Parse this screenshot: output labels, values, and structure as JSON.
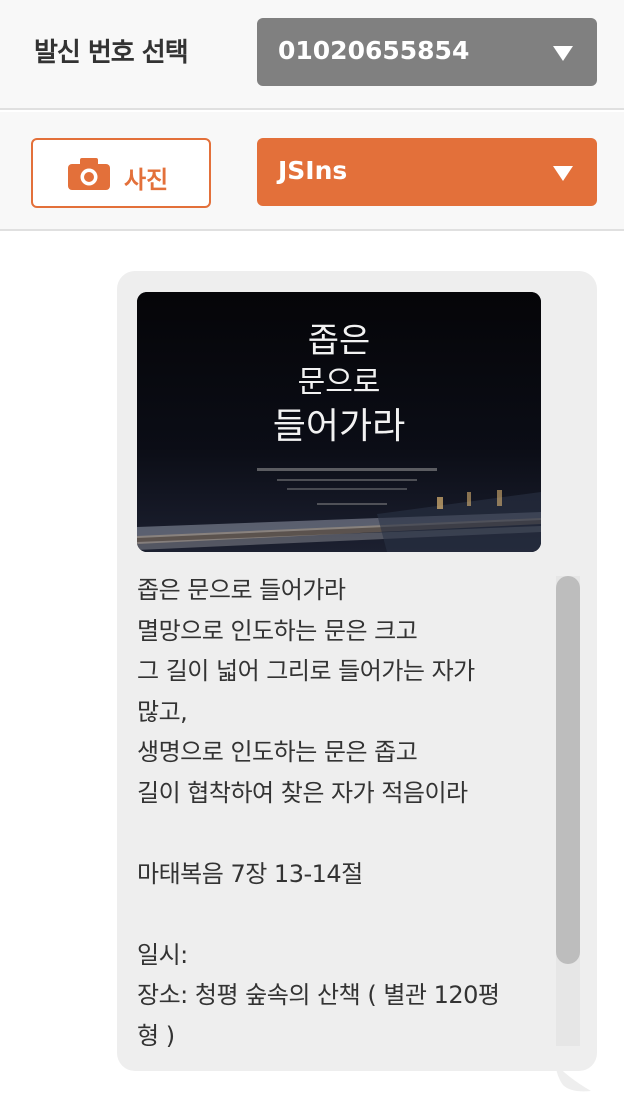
{
  "header": {
    "sender_label": "발신 번호 선택",
    "sender_number": "01020655854"
  },
  "toolbar": {
    "photo_label": "사진",
    "template_value": "JSIns"
  },
  "colors": {
    "accent": "#e3703a",
    "select_gray": "#808080",
    "bubble_bg": "#eeeeee"
  },
  "icons": {
    "camera": "camera-icon",
    "dropdown": "chevron-down-icon"
  },
  "message": {
    "poster": {
      "title_line1": "좁은",
      "title_line2": "문으로",
      "title_line3": "들어가라"
    },
    "lines": [
      "좁은 문으로 들어가라",
      "멸망으로 인도하는 문은 크고",
      "그 길이 넓어 그리로 들어가는 자가",
      "많고,",
      "생명으로 인도하는 문은 좁고",
      "길이 협착하여 찾은 자가 적음이라",
      "",
      "마태복음 7장 13-14절",
      "",
      "일시:",
      "장소: 청평 숲속의 산책 ( 별관 120평",
      "형 )"
    ]
  }
}
